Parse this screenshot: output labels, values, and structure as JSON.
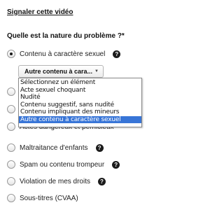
{
  "title": "Signaler cette vidéo",
  "question": "Quelle est la nature du problème ?*",
  "help_glyph": "?",
  "selected_option": {
    "label": "Contenu à caractère sexuel",
    "select": {
      "value": "Autre contenu à cara...",
      "arrow": "▼",
      "options": [
        "Sélectionnez un élément",
        "Acte sexuel choquant",
        "Nudité",
        "Contenu suggestif, sans nudité",
        "Contenu impliquant des mineurs",
        "Autre contenu à caractère sexuel"
      ],
      "highlighted_index": 5
    }
  },
  "partially_hidden_option": {
    "label": "Actes dangereux et pernicieux"
  },
  "options": [
    {
      "label": "Maltraitance d'enfants"
    },
    {
      "label": "Spam ou contenu trompeur"
    },
    {
      "label": "Violation de mes droits"
    },
    {
      "label": "Sous-titres (CVAA)"
    }
  ],
  "colors": {
    "highlight": "#3875d7",
    "help_icon": "#1b1b1b"
  }
}
